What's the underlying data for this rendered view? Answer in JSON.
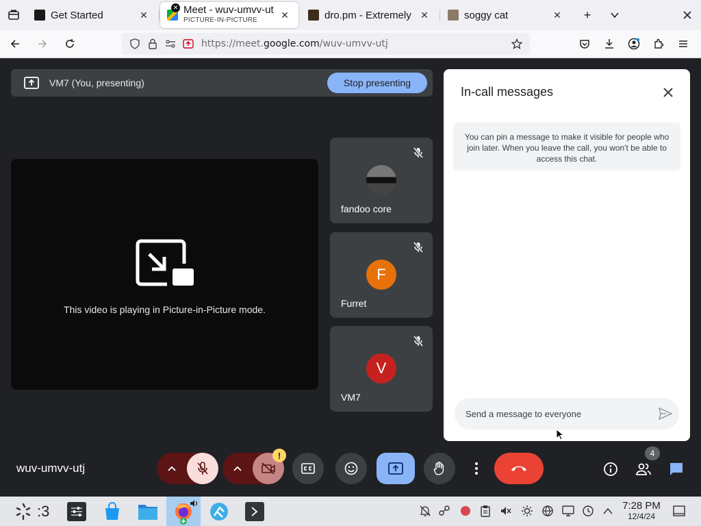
{
  "browser": {
    "tabs": [
      {
        "label": "Get Started",
        "close": "✕"
      },
      {
        "label": "Meet - wuv-umvv-utj",
        "sublabel": "PICTURE-IN-PICTURE",
        "close": "✕"
      },
      {
        "label": "dro.pm - Extremely Sh",
        "close": "✕"
      },
      {
        "label": "soggy cat",
        "close": "✕"
      }
    ],
    "new_tab": "+",
    "url_prefix": "https://meet.",
    "url_domain": "google.com",
    "url_path": "/wuv-umvv-utj"
  },
  "meet": {
    "presenting_label": "VM7 (You, presenting)",
    "stop_presenting": "Stop presenting",
    "pip_message": "This video is playing in Picture-in-Picture mode.",
    "participants": [
      {
        "name": "fandoo core",
        "initial": "",
        "color": "#2b2b2b"
      },
      {
        "name": "Furret",
        "initial": "F",
        "color": "#e8710a"
      },
      {
        "name": "VM7",
        "initial": "V",
        "color": "#c5221f"
      }
    ],
    "chat": {
      "title": "In-call messages",
      "info": "You can pin a message to make it visible for people who join later. When you leave the call, you won't be able to access this chat.",
      "placeholder": "Send a message to everyone"
    },
    "meeting_code": "wuv-umvv-utj",
    "warning_mark": "!",
    "people_count": "4"
  },
  "taskbar": {
    "label": ":3",
    "time": "7:28 PM",
    "date": "12/4/24"
  },
  "colors": {
    "accent_blue": "#8ab4f8",
    "end_call_red": "#ea4335",
    "muted_dark_red": "#5c1414"
  }
}
